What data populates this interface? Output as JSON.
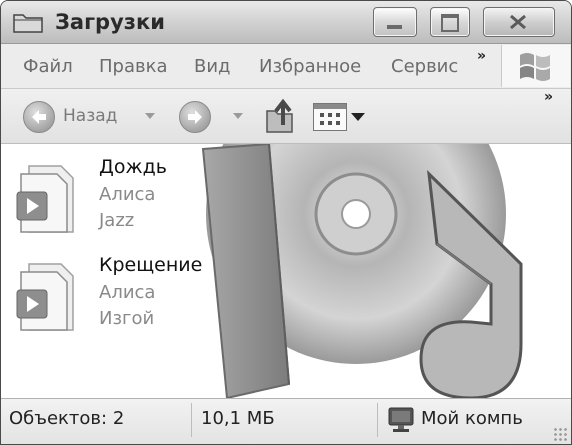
{
  "window": {
    "title": "Загрузки",
    "icon": "folder-icon"
  },
  "menu": {
    "items": [
      "Файл",
      "Правка",
      "Вид",
      "Избранное",
      "Сервис"
    ],
    "overflow": "»"
  },
  "toolbar": {
    "back_label": "Назад",
    "overflow": "»"
  },
  "files": [
    {
      "name": "Дождь",
      "artist": "Алиса",
      "album": "Jazz",
      "icon": "audio-file-icon"
    },
    {
      "name": "Крещение",
      "artist": "Алиса",
      "album": "Изгой",
      "icon": "audio-file-icon"
    }
  ],
  "status": {
    "objects": "Объектов: 2",
    "size": "10,1 МБ",
    "location": "Мой компь"
  }
}
